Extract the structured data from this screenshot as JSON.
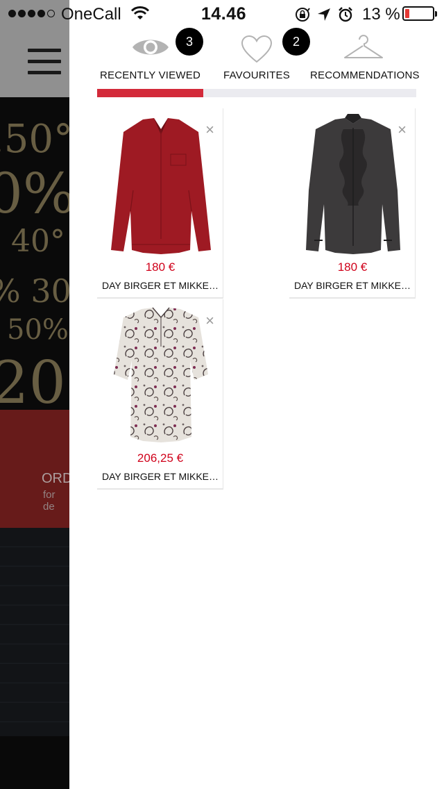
{
  "status_bar": {
    "carrier": "OneCall",
    "time": "14.46",
    "battery_percent": "13 %",
    "battery_level": 0.13,
    "signal_bars": 4
  },
  "background_page": {
    "promo_lines": [
      ".50°",
      "0%",
      "40°",
      "% 30",
      "50%",
      "20°"
    ],
    "order_text": "ORD",
    "order_subtext": "for de",
    "colors": {
      "header": "#9a9a9a",
      "promo": "#0b0b0b",
      "banner": "#6e1d1c"
    }
  },
  "tabs": [
    {
      "label": "RECENTLY VIEWED",
      "icon": "eye-icon",
      "badge": "3",
      "active": true
    },
    {
      "label": "FAVOURITES",
      "icon": "heart-icon",
      "badge": "2",
      "active": false
    },
    {
      "label": "RECOMMENDATIONS",
      "icon": "hanger-icon",
      "badge": "",
      "active": false
    }
  ],
  "products": [
    {
      "price": "180 €",
      "name": "DAY BIRGER ET MIKKE…",
      "image": "red-blouse"
    },
    {
      "price": "180 €",
      "name": "DAY BIRGER ET MIKKE…",
      "image": "black-ruffle-shirt"
    },
    {
      "price": "206,25 €",
      "name": "DAY BIRGER ET MIKKE…",
      "image": "paisley-blouse"
    }
  ],
  "colors": {
    "accent": "#d32a3a",
    "price": "#d0021b",
    "badge": "#000000",
    "tab_track": "#ebebf0"
  }
}
